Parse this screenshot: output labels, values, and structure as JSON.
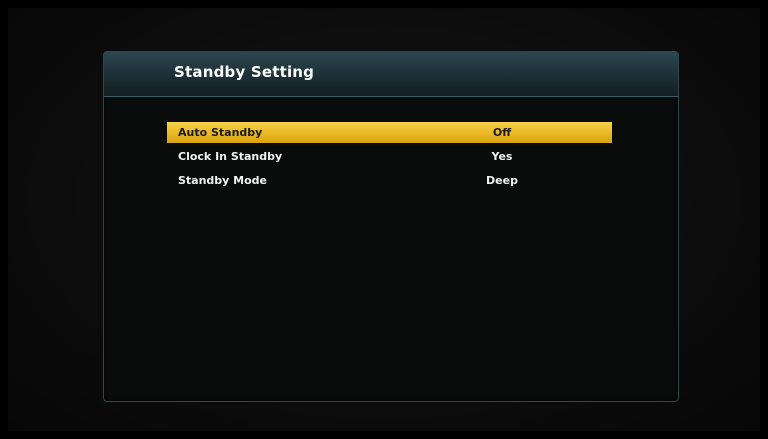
{
  "dialog": {
    "title": "Standby Setting"
  },
  "settings": [
    {
      "label": "Auto Standby",
      "value": "Off",
      "selected": true
    },
    {
      "label": "Clock In Standby",
      "value": "Yes",
      "selected": false
    },
    {
      "label": "Standby Mode",
      "value": "Deep",
      "selected": false
    }
  ],
  "colors": {
    "highlight": "#e9b823",
    "header": "#2c4650",
    "border": "#2b4850",
    "background": "#0a0c0b"
  }
}
